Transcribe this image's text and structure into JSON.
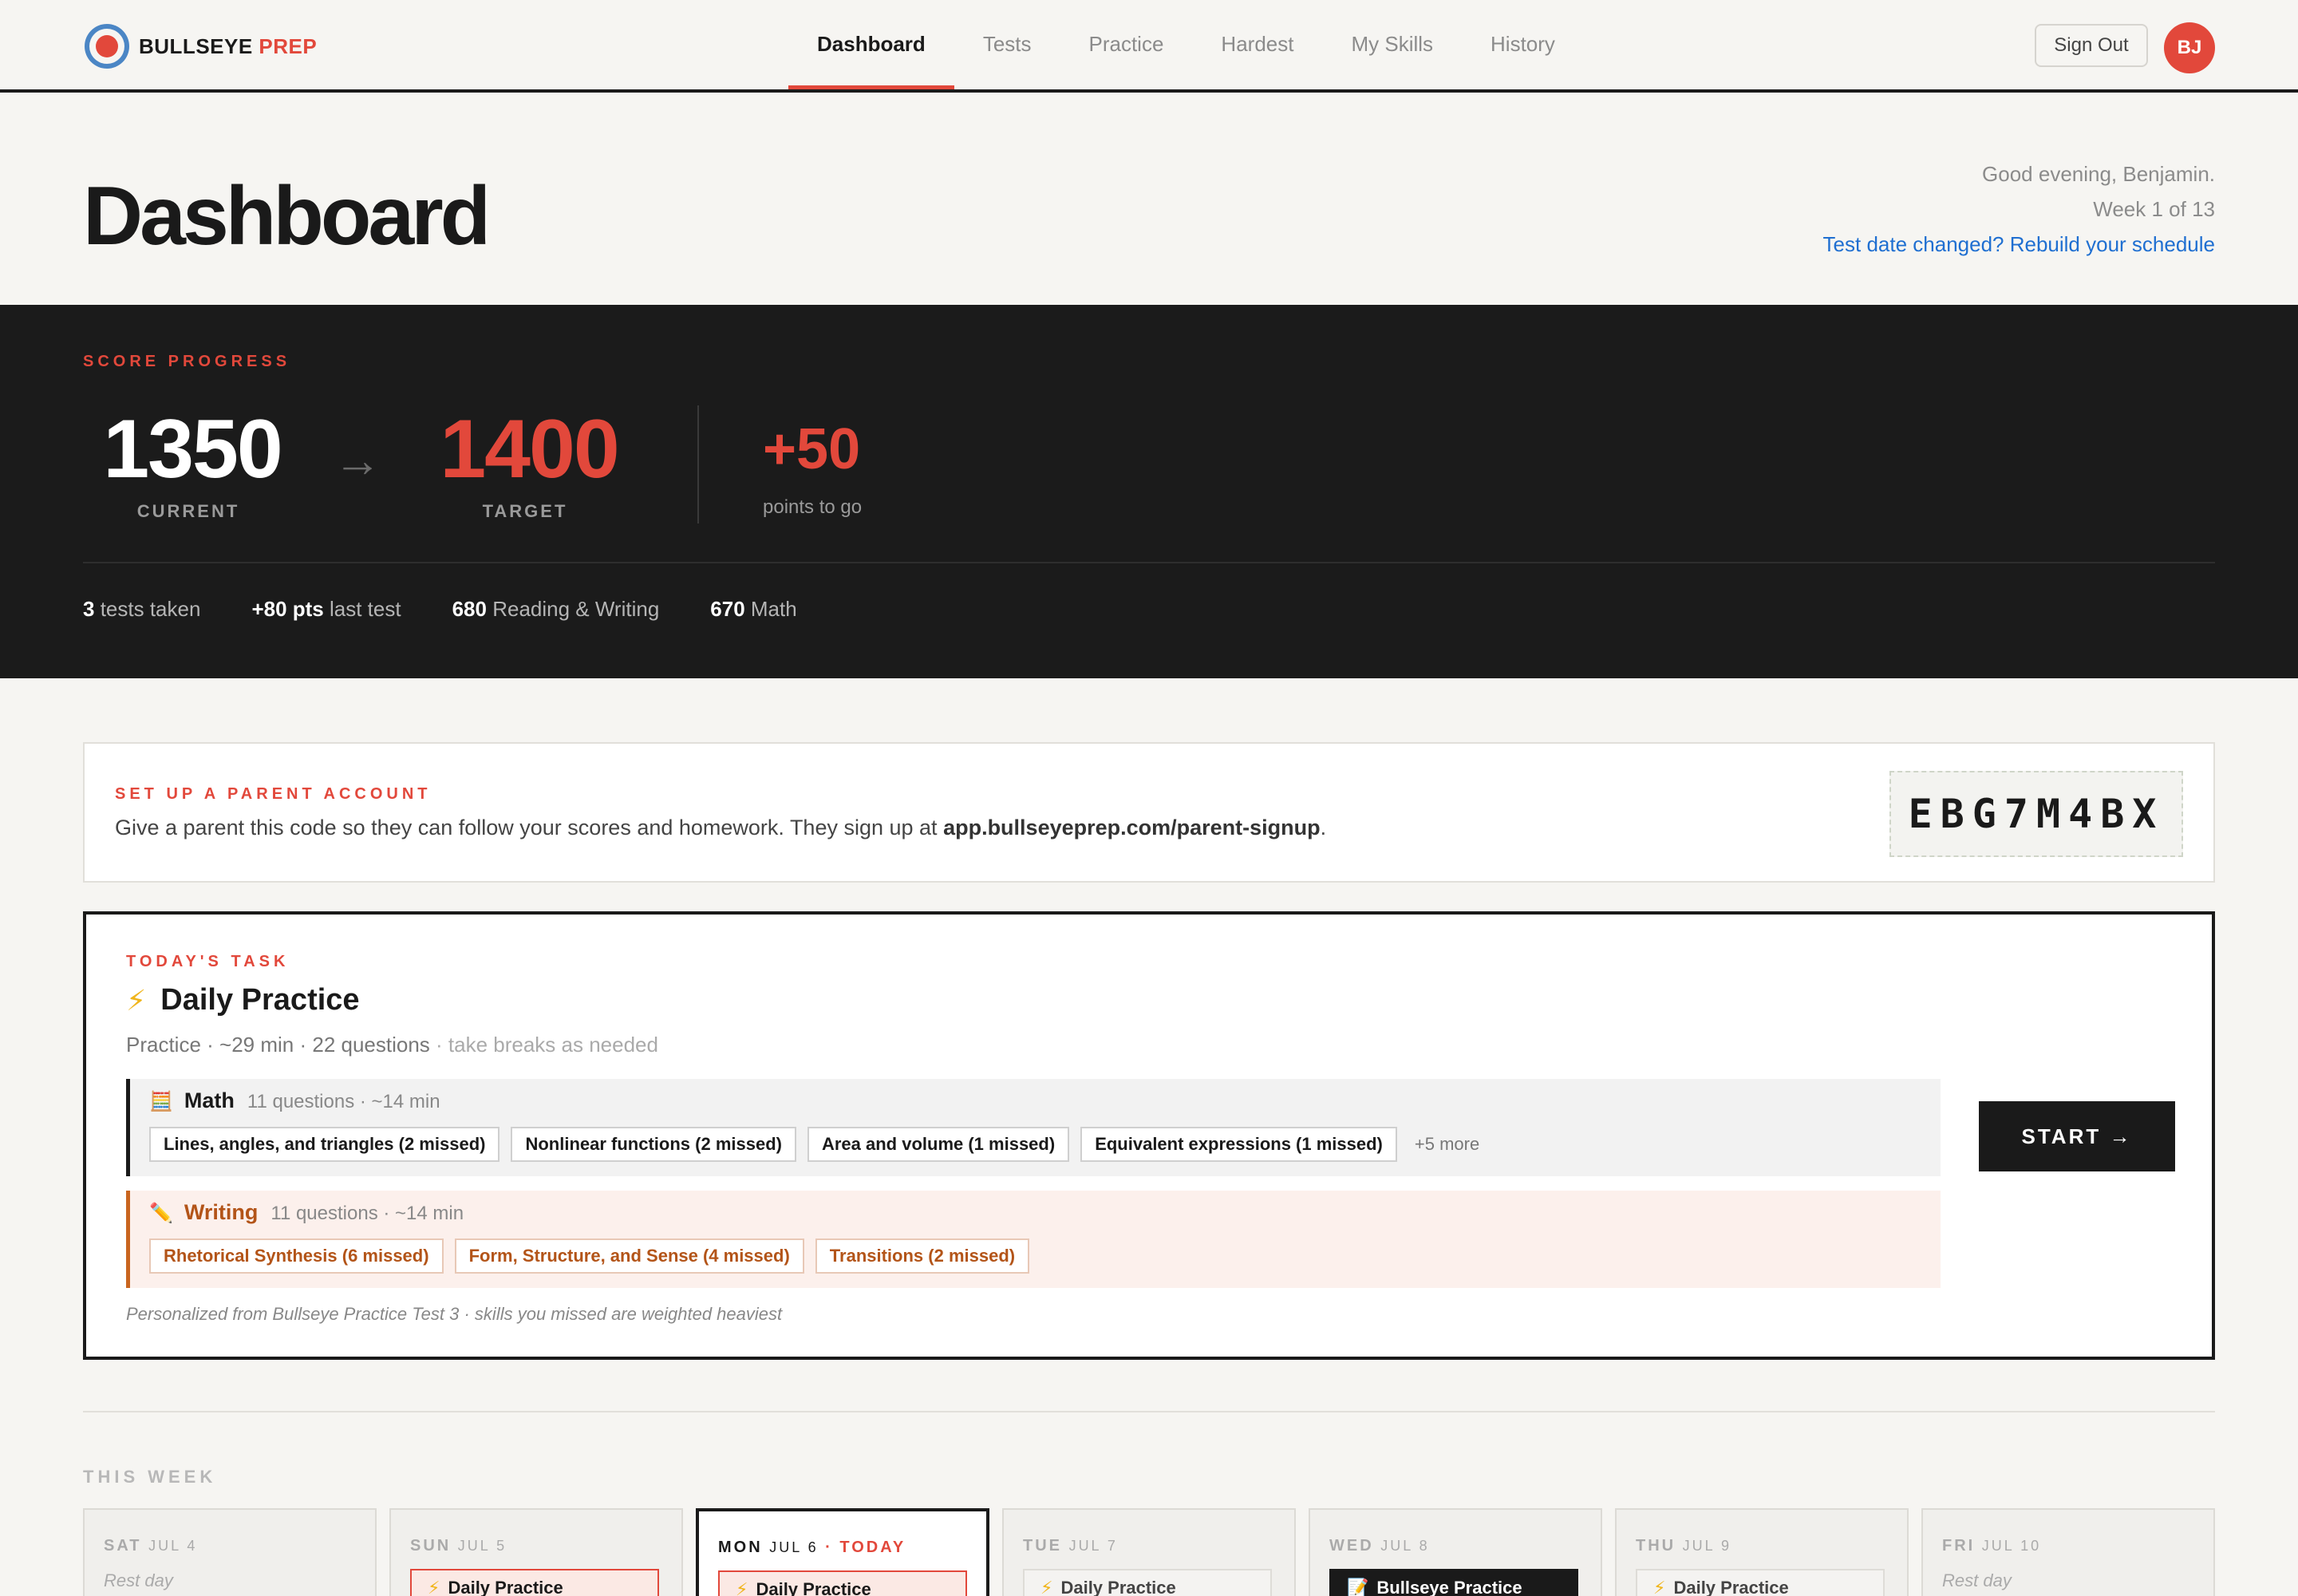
{
  "brand": {
    "word1": "BULLSEYE",
    "word2": "PREP"
  },
  "nav": {
    "tabs": [
      {
        "label": "Dashboard",
        "active": true
      },
      {
        "label": "Tests"
      },
      {
        "label": "Practice"
      },
      {
        "label": "Hardest"
      },
      {
        "label": "My Skills"
      },
      {
        "label": "History"
      }
    ],
    "sign_out": "Sign Out",
    "avatar_initials": "BJ"
  },
  "header": {
    "title": "Dashboard",
    "greeting": "Good evening, Benjamin.",
    "week": "Week 1 of 13",
    "rebuild_link": "Test date changed? Rebuild your schedule"
  },
  "score": {
    "eyebrow": "SCORE PROGRESS",
    "current": "1350",
    "current_label": "CURRENT",
    "arrow": "→",
    "target": "1400",
    "target_label": "TARGET",
    "delta": "+50",
    "delta_label": "points to go",
    "stats": [
      {
        "value": "3",
        "label": " tests taken"
      },
      {
        "value": "+80 pts",
        "label": " last test"
      },
      {
        "value": "680",
        "label": " Reading & Writing"
      },
      {
        "value": "670",
        "label": " Math"
      }
    ]
  },
  "parent": {
    "eyebrow": "SET UP A PARENT ACCOUNT",
    "desc_prefix": "Give a parent this code so they can follow your scores and homework. They sign up at ",
    "desc_url": "app.bullseyeprep.com/parent-signup",
    "desc_suffix": ".",
    "code": "EBG7M4BX"
  },
  "task": {
    "eyebrow": "TODAY'S TASK",
    "title": "Daily Practice",
    "meta": "Practice · ~29 min · 22 questions",
    "meta_soft": " · take breaks as needed",
    "math": {
      "name": "Math",
      "meta": "11 questions · ~14 min",
      "chips": [
        "Lines, angles, and triangles (2 missed)",
        "Nonlinear functions (2 missed)",
        "Area and volume (1 missed)",
        "Equivalent expressions (1 missed)"
      ],
      "more": "+5 more"
    },
    "writing": {
      "name": "Writing",
      "meta": "11 questions · ~14 min",
      "chips": [
        "Rhetorical Synthesis (6 missed)",
        "Form, Structure, and Sense (4 missed)",
        "Transitions (2 missed)"
      ]
    },
    "start": "START →",
    "note": "Personalized from Bullseye Practice Test 3 · skills you missed are weighted heaviest"
  },
  "week": {
    "eyebrow": "THIS WEEK",
    "days": [
      {
        "day": "SAT",
        "date": "JUL 4",
        "rest": "Rest day"
      },
      {
        "day": "SUN",
        "date": "JUL 5",
        "task": "Daily Practice"
      },
      {
        "day": "MON",
        "date": "JUL 6",
        "today_label": "· TODAY",
        "task": "Daily Practice"
      },
      {
        "day": "TUE",
        "date": "JUL 7",
        "task": "Daily Practice"
      },
      {
        "day": "WED",
        "date": "JUL 8",
        "task": "Bullseye Practice"
      },
      {
        "day": "THU",
        "date": "JUL 9",
        "task": "Daily Practice"
      },
      {
        "day": "FRI",
        "date": "JUL 10",
        "rest": "Rest day"
      }
    ]
  },
  "colors": {
    "accent": "#e2483b",
    "dark": "#1b1b1b",
    "link": "#1f6fd1",
    "writing": "#b35418"
  }
}
